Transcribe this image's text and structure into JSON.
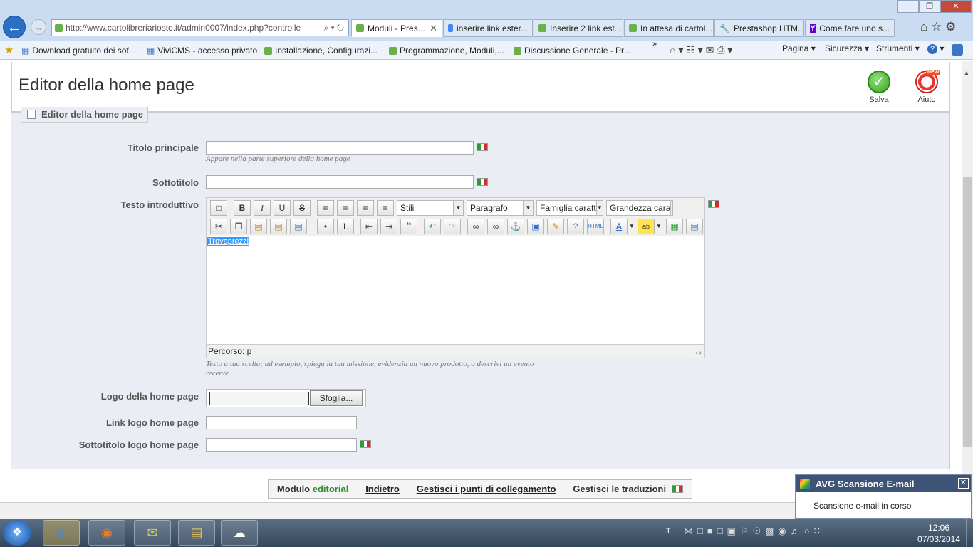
{
  "browser": {
    "url": "http://www.cartolibreriariosto.it/admin0007/index.php?controlle",
    "tabs": [
      {
        "label": "Moduli - Pres...",
        "active": true
      },
      {
        "label": "inserire link ester..."
      },
      {
        "label": "Inserire 2 link est..."
      },
      {
        "label": "In attesa di cartol..."
      },
      {
        "label": "Prestashop HTM..."
      },
      {
        "label": "Come fare uno s..."
      }
    ],
    "bookmarks": [
      "Download gratuito dei sof...",
      "ViviCMS - accesso privato",
      "Installazione, Configurazi...",
      "Programmazione, Moduli,...",
      "Discussione Generale - Pr..."
    ],
    "menus": {
      "page": "Pagina",
      "security": "Sicurezza",
      "tools": "Strumenti"
    }
  },
  "header": {
    "title": "Editor della home page",
    "save_label": "Salva",
    "help_label": "Aiuto",
    "help_badge": "NEW"
  },
  "panel": {
    "legend": "Editor della home page",
    "main_title": {
      "label": "Titolo principale",
      "value": "",
      "hint": "Appare nella parte superiore della home page"
    },
    "subtitle": {
      "label": "Sottotitolo",
      "value": ""
    },
    "intro_text": {
      "label": "Testo introduttivo",
      "content": "Trovaprezzi",
      "path": "Percorso: p",
      "hint": "Testo a tua scelta; ad esempio, spiega la tua missione, evidenzia un nuovo prodotto, o descrivi un evento recente."
    },
    "logo": {
      "label": "Logo della home page",
      "browse": "Sfoglia..."
    },
    "logo_link": {
      "label": "Link logo home page",
      "value": ""
    },
    "logo_subtitle": {
      "label": "Sottotitolo logo home page",
      "value": ""
    }
  },
  "editor_toolbar": {
    "styles": "Stili",
    "format": "Paragrafo",
    "font_family": "Famiglia caratt",
    "font_size": "Grandezza cara"
  },
  "bottom_nav": {
    "module_prefix": "Modulo",
    "module_name": "editorial",
    "back": "Indietro",
    "hooks": "Gestisci i punti di collegamento",
    "translations": "Gestisci le traduzioni"
  },
  "avg": {
    "title": "AVG Scansione E-mail",
    "message": "Scansione e-mail in corso"
  },
  "taskbar": {
    "lang": "IT",
    "time": "12:06",
    "date": "07/03/2014"
  },
  "colors": {
    "accent_green": "#2e8b2e",
    "flag_green": "#2e9a3a",
    "flag_red": "#d42b2b"
  }
}
